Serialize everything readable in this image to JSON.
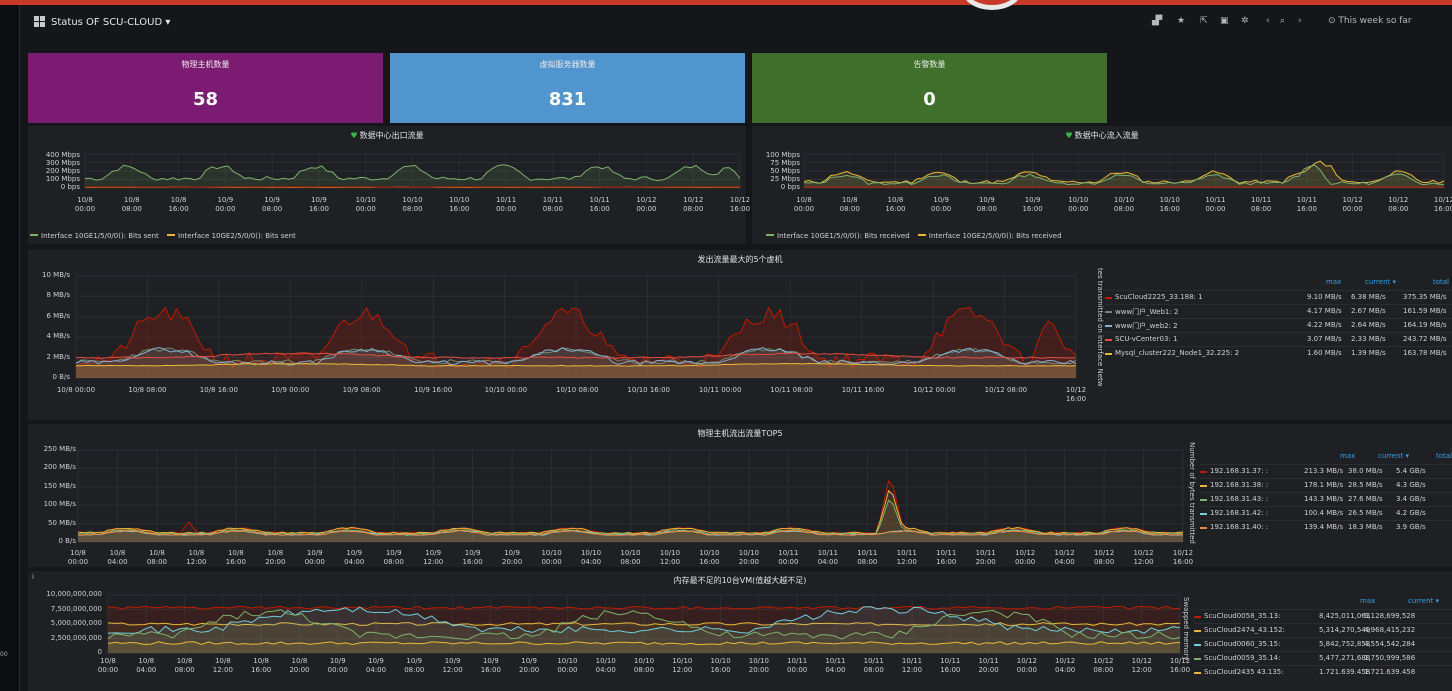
{
  "header": {
    "title": "Status OF SCU-CLOUD ▾",
    "time_range": "⊙ This week so far",
    "icons": [
      "graph-add-icon",
      "star-icon",
      "share-icon",
      "save-icon",
      "gear-icon",
      "chevron-left-icon",
      "zoom-out-icon",
      "chevron-right-icon"
    ]
  },
  "left_strip_label": "00",
  "stats": [
    {
      "title": "物理主机数量",
      "value": "58",
      "color": "#7b1c72"
    },
    {
      "title": "虚拟服务器数量",
      "value": "831",
      "color": "#5195ce"
    },
    {
      "title": "告警数量",
      "value": "0",
      "color": "#3f6f2b"
    }
  ],
  "panel_out": {
    "title": "数据中心出口流量",
    "y_ticks": [
      "400 Mbps",
      "300 Mbps",
      "200 Mbps",
      "100 Mbps",
      "0 bps"
    ],
    "x_ticks": [
      "10/8\n00:00",
      "10/8\n08:00",
      "10/8\n16:00",
      "10/9\n00:00",
      "10/9\n08:00",
      "10/9\n16:00",
      "10/10\n00:00",
      "10/10\n08:00",
      "10/10\n16:00",
      "10/11\n00:00",
      "10/11\n08:00",
      "10/11\n16:00",
      "10/12\n00:00",
      "10/12\n08:00",
      "10/12\n16:00"
    ],
    "legend": [
      {
        "label": "Interface 10GE1/5/0/0(): Bits sent",
        "color": "#7eb26d"
      },
      {
        "label": "Interface 10GE2/5/0/0(): Bits sent",
        "color": "#eab839"
      }
    ]
  },
  "panel_in": {
    "title": "数据中心流入流量",
    "y_ticks": [
      "100 Mbps",
      "75 Mbps",
      "50 Mbps",
      "25 Mbps",
      "0 bps"
    ],
    "x_ticks": [
      "10/8\n00:00",
      "10/8\n08:00",
      "10/8\n16:00",
      "10/9\n00:00",
      "10/9\n08:00",
      "10/9\n16:00",
      "10/10\n00:00",
      "10/10\n08:00",
      "10/10\n16:00",
      "10/11\n00:00",
      "10/11\n08:00",
      "10/11\n16:00",
      "10/12\n00:00",
      "10/12\n08:00",
      "10/12\n16:00"
    ],
    "legend": [
      {
        "label": "Interface 10GE1/5/0/0(): Bits received",
        "color": "#7eb26d"
      },
      {
        "label": "Interface 10GE2/5/0/0(): Bits received",
        "color": "#eab839"
      }
    ]
  },
  "panel_vm_out": {
    "title": "发出流量最大的5个虚机",
    "y_axis_label": "tes transmitted on interface Netw",
    "y_ticks": [
      "10 MB/s",
      "8 MB/s",
      "6 MB/s",
      "4 MB/s",
      "2 MB/s",
      "0 B/s"
    ],
    "x_ticks": [
      "10/8 00:00",
      "10/8 08:00",
      "10/8 16:00",
      "10/9 00:00",
      "10/9 08:00",
      "10/9 16:00",
      "10/10 00:00",
      "10/10 08:00",
      "10/10 16:00",
      "10/11 00:00",
      "10/11 08:00",
      "10/11 16:00",
      "10/12 00:00",
      "10/12 08:00",
      "10/12\n16:00"
    ],
    "columns": [
      "max",
      "current ▾",
      "total"
    ],
    "rows": [
      {
        "name": "ScuCloud2225_33.188: 1",
        "max": "9.10 MB/s",
        "current": "6.38 MB/s",
        "total": "375.35 MB/s",
        "color": "#bf1b00"
      },
      {
        "name": "www门户_Web1: 2",
        "max": "4.17 MB/s",
        "current": "2.67 MB/s",
        "total": "161.59 MB/s",
        "color": "#6d8c6b"
      },
      {
        "name": "www门户_web2: 2",
        "max": "4.22 MB/s",
        "current": "2.64 MB/s",
        "total": "164.19 MB/s",
        "color": "#82b5d8"
      },
      {
        "name": "SCU-vCenter03: 1",
        "max": "3.07 MB/s",
        "current": "2.33 MB/s",
        "total": "243.72 MB/s",
        "color": "#e24d42"
      },
      {
        "name": "Mysql_cluster222_Node1_32.225: 2",
        "max": "1.60 MB/s",
        "current": "1.39 MB/s",
        "total": "163.78 MB/s",
        "color": "#eab839"
      }
    ]
  },
  "panel_host_out": {
    "title": "物理主机流出流量TOP5",
    "y_axis_label": "Number of bytes transmitted",
    "y_ticks": [
      "250 MB/s",
      "200 MB/s",
      "150 MB/s",
      "100 MB/s",
      "50 MB/s",
      "0 B/s"
    ],
    "x_ticks": [
      "10/8\n00:00",
      "10/8\n04:00",
      "10/8\n08:00",
      "10/8\n12:00",
      "10/8\n16:00",
      "10/8\n20:00",
      "10/9\n00:00",
      "10/9\n04:00",
      "10/9\n08:00",
      "10/9\n12:00",
      "10/9\n16:00",
      "10/9\n20:00",
      "10/10\n00:00",
      "10/10\n04:00",
      "10/10\n08:00",
      "10/10\n12:00",
      "10/10\n16:00",
      "10/10\n20:00",
      "10/11\n00:00",
      "10/11\n04:00",
      "10/11\n08:00",
      "10/11\n12:00",
      "10/11\n16:00",
      "10/11\n20:00",
      "10/12\n00:00",
      "10/12\n04:00",
      "10/12\n08:00",
      "10/12\n12:00",
      "10/12\n16:00"
    ],
    "columns": [
      "max",
      "current ▾",
      "total"
    ],
    "rows": [
      {
        "name": "192.168.31.37: :",
        "max": "213.3 MB/s",
        "current": "38.0 MB/s",
        "total": "5.4 GB/s",
        "color": "#bf1b00"
      },
      {
        "name": "192.168.31.38: :",
        "max": "178.1 MB/s",
        "current": "28.5 MB/s",
        "total": "4.3 GB/s",
        "color": "#eab839"
      },
      {
        "name": "192.168.31.43: :",
        "max": "143.3 MB/s",
        "current": "27.6 MB/s",
        "total": "3.4 GB/s",
        "color": "#7eb26d"
      },
      {
        "name": "192.168.31.42: :",
        "max": "100.4 MB/s",
        "current": "26.5 MB/s",
        "total": "4.2 GB/s",
        "color": "#6ed0e0"
      },
      {
        "name": "192.168.31.40: :",
        "max": "139.4 MB/s",
        "current": "18.3 MB/s",
        "total": "3.9 GB/s",
        "color": "#ef843c"
      }
    ]
  },
  "panel_mem": {
    "title": "内存最不足的10台VM(值越大越不足)",
    "info": "i",
    "y_axis_label": "Swapped memory",
    "y_ticks": [
      "10,000,000,000",
      "7,500,000,000",
      "5,000,000,000",
      "2,500,000,000",
      "0"
    ],
    "x_ticks": [
      "10/8\n00:00",
      "10/8\n04:00",
      "10/8\n08:00",
      "10/8\n12:00",
      "10/8\n16:00",
      "10/8\n20:00",
      "10/9\n00:00",
      "10/9\n04:00",
      "10/9\n08:00",
      "10/9\n12:00",
      "10/9\n16:00",
      "10/9\n20:00",
      "10/10\n00:00",
      "10/10\n04:00",
      "10/10\n08:00",
      "10/10\n12:00",
      "10/10\n16:00",
      "10/10\n20:00",
      "10/11\n00:00",
      "10/11\n04:00",
      "10/11\n08:00",
      "10/11\n12:00",
      "10/11\n16:00",
      "10/11\n20:00",
      "10/12\n00:00",
      "10/12\n04:00",
      "10/12\n08:00",
      "10/12\n12:00",
      "10/12\n16:00"
    ],
    "columns": [
      "max",
      "current ▾"
    ],
    "rows": [
      {
        "name": "ScuCloud0058_35.13:",
        "max": "8,425,011,063",
        "current": "6,128,699,528",
        "color": "#bf1b00"
      },
      {
        "name": "ScuCloud2474_43.152:",
        "max": "5,314,270,549",
        "current": "4,968,415,232",
        "color": "#eab839"
      },
      {
        "name": "ScuCloud0060_35.15:",
        "max": "5,842,752,853",
        "current": "4,554,542,284",
        "color": "#6ed0e0"
      },
      {
        "name": "ScuCloud0059_35.14:",
        "max": "5,477,271,688",
        "current": "1,750,999,586",
        "color": "#7eb26d"
      },
      {
        "name": "ScuCloud2435 43.135:",
        "max": "1.721.639.458",
        "current": "1.721.639.458",
        "color": "#eab839"
      }
    ]
  }
}
